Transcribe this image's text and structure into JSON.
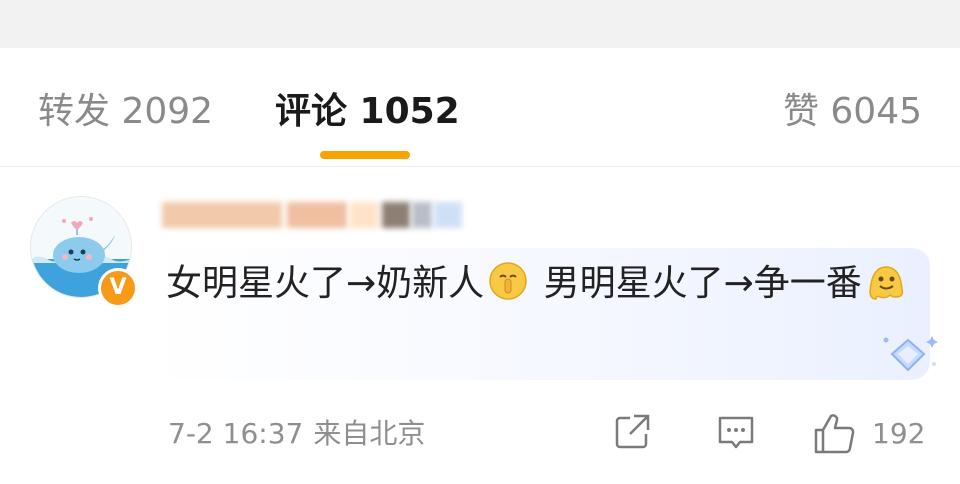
{
  "tabs": {
    "repost": "转发 2092",
    "comments": "评论 1052",
    "likes": "赞 6045"
  },
  "colors": {
    "accent": "#f7a400",
    "badge": "#f79a1a",
    "text": "#222222",
    "muted": "#8f8f8f"
  },
  "comment": {
    "text_part1": "女明星火了→奶新人",
    "text_part2": "男明星火了→争一番",
    "emoji1": "shushing-face-emoji",
    "emoji2": "melting-face-emoji",
    "badge_label": "V",
    "time": "7-2 16:37",
    "location": "来自北京",
    "like_count": "192"
  },
  "icons": {
    "share": "share-icon",
    "reply": "comment-icon",
    "like": "thumbs-up-icon",
    "deco": "diamond-decoration-icon"
  }
}
